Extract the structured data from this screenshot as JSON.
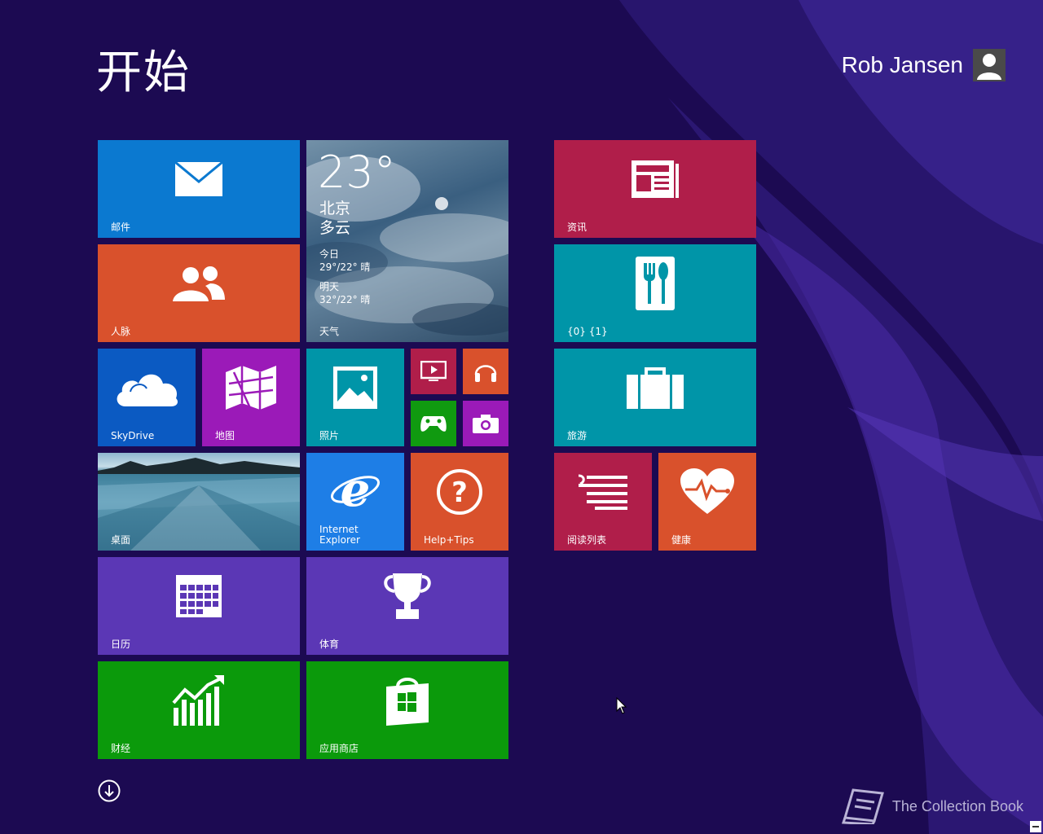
{
  "screen": {
    "title": "开始",
    "user_name": "Rob Jansen",
    "watermark_text": "The Collection Book"
  },
  "colors": {
    "background": "#1c0a52",
    "mail": "#0b79d0",
    "people": "#d9512c",
    "skydrive": "#0b5ac2",
    "maps": "#9b1ab8",
    "photos": "#0095a8",
    "video": "#b01e4a",
    "music": "#d9512c",
    "games": "#109a10",
    "camera": "#9b1ab8",
    "ie": "#1e7ee6",
    "help": "#d9512c",
    "calendar": "#5b37b5",
    "sports": "#5b37b5",
    "finance": "#0b9a0b",
    "store": "#0b9a0b",
    "news": "#b01e4a",
    "food": "#0095a8",
    "travel": "#0095a8",
    "reading": "#b01e4a",
    "health": "#d9512c"
  },
  "tiles": {
    "mail": {
      "label": "邮件",
      "icon": "mail-icon"
    },
    "people": {
      "label": "人脉",
      "icon": "people-icon"
    },
    "weather": {
      "label": "天气",
      "temp": "23°",
      "city": "北京",
      "condition": "多云",
      "today_label": "今日",
      "today_forecast": "29°/22° 晴",
      "tomorrow_label": "明天",
      "tomorrow_forecast": "32°/22° 晴",
      "icon": "weather-icon"
    },
    "skydrive": {
      "label": "SkyDrive",
      "icon": "cloud-icon"
    },
    "maps": {
      "label": "地图",
      "icon": "map-icon"
    },
    "photos": {
      "label": "照片",
      "icon": "photo-icon"
    },
    "video": {
      "icon": "video-icon"
    },
    "music": {
      "icon": "headphones-icon"
    },
    "games": {
      "icon": "gamepad-icon"
    },
    "camera": {
      "icon": "camera-icon"
    },
    "desktop": {
      "label": "桌面",
      "icon": "desktop-icon"
    },
    "ie": {
      "label_line1": "Internet",
      "label_line2": "Explorer",
      "icon": "internet-explorer-icon"
    },
    "help": {
      "label": "Help+Tips",
      "icon": "help-icon"
    },
    "calendar": {
      "label": "日历",
      "icon": "calendar-icon"
    },
    "sports": {
      "label": "体育",
      "icon": "trophy-icon"
    },
    "finance": {
      "label": "财经",
      "icon": "finance-chart-icon"
    },
    "store": {
      "label": "应用商店",
      "icon": "store-icon"
    },
    "news": {
      "label": "资讯",
      "icon": "news-icon"
    },
    "food": {
      "label": "{0} {1}",
      "icon": "food-icon"
    },
    "travel": {
      "label": "旅游",
      "icon": "suitcase-icon"
    },
    "reading": {
      "label": "阅读列表",
      "icon": "reading-list-icon"
    },
    "health": {
      "label": "健康",
      "icon": "heart-icon"
    }
  }
}
